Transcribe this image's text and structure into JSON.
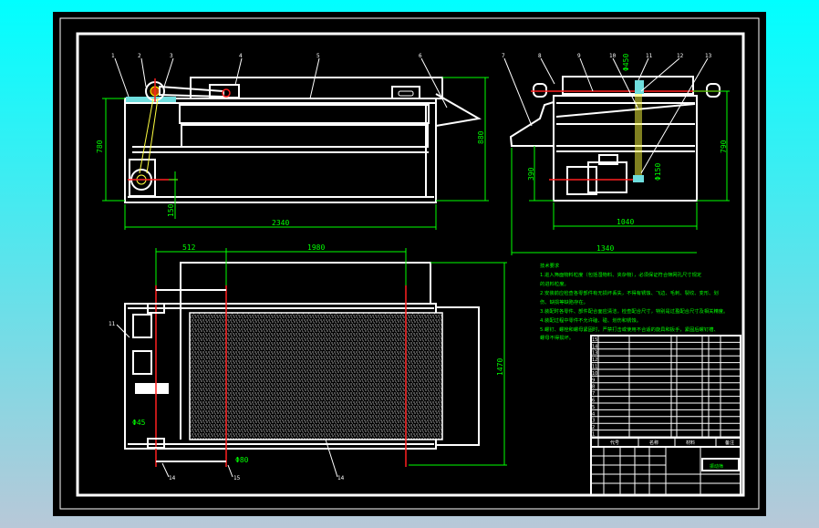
{
  "colors": {
    "background": "#00ffff",
    "drawing_area": "#000000",
    "geometry": "#ffffff",
    "dimensions": "#00ff00",
    "center_lines": "#ff2020",
    "belt": "#ffff40"
  },
  "front_view": {
    "part_labels": [
      "1",
      "2",
      "3",
      "4",
      "5",
      "6"
    ],
    "dimensions": {
      "width": "2340",
      "height_left": "780",
      "height_right": "880",
      "offset": "150"
    }
  },
  "side_view": {
    "part_labels": [
      "7",
      "8",
      "9",
      "10",
      "11",
      "12",
      "13"
    ],
    "dimensions": {
      "inner_width": "1040",
      "overall_width": "1340",
      "height": "790",
      "motor_height": "390",
      "pulley_top": "Φ450",
      "pulley_bottom": "Φ150"
    }
  },
  "top_view": {
    "part_labels": [
      "11",
      "14",
      "15",
      "14"
    ],
    "dimensions": {
      "left_span": "512",
      "main_span": "1980",
      "depth": "1470",
      "shaft_small": "Φ45",
      "shaft_large": "Φ80"
    }
  },
  "technical_requirements": {
    "title": "技术要求",
    "items": [
      "1.进入筛面物料粒度（包括湿物料、夹杂物），必须保证符合筛网孔尺寸规定",
      "的进料粒度。",
      "2.安装前应检查各零部件有无损坏丢失，不得有锈蚀、飞边、毛刺、裂纹、变形、划",
      "伤、缺损等缺陷存在。",
      "3.装配时各零件、部件配合面应清洁，检查配合尺寸，特别是过盈配合尺寸及相关精度。",
      "4.装配过程中零件不允许磕、碰、划伤和锈蚀。",
      "5.螺钉、螺栓和螺母紧固时，严禁打击或使用不合适的旋具和扳手，紧固后螺钉槽、",
      "螺母不得损坏。"
    ]
  },
  "title_block": {
    "headers": [
      "序号",
      "代号",
      "名称",
      "数量",
      "材料",
      "单件",
      "总计",
      "备注"
    ],
    "drawing_title": "振动筛",
    "rows": [
      "15",
      "14",
      "13",
      "12",
      "11",
      "10",
      "9",
      "8",
      "7",
      "6",
      "5",
      "4",
      "3",
      "2",
      "1"
    ]
  }
}
